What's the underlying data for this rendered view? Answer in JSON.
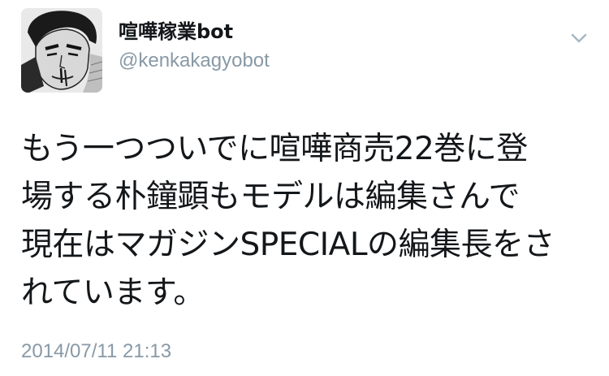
{
  "user": {
    "display_name": "喧嘩稼業bot",
    "screen_name": "@kenkakagyobot",
    "avatar": "manga-character-portrait"
  },
  "menu": {
    "icon": "chevron-down-icon"
  },
  "tweet": {
    "lines": [
      "もう一つついでに喧嘩商売22巻に登",
      "場する朴鐘顕もモデルは編集さんで",
      "現在はマガジンSPECIALの編集長をさ",
      "れています。"
    ],
    "timestamp": "2014/07/11 21:13"
  },
  "colors": {
    "text": "#14171a",
    "secondary": "#8899a6",
    "background": "#ffffff"
  }
}
